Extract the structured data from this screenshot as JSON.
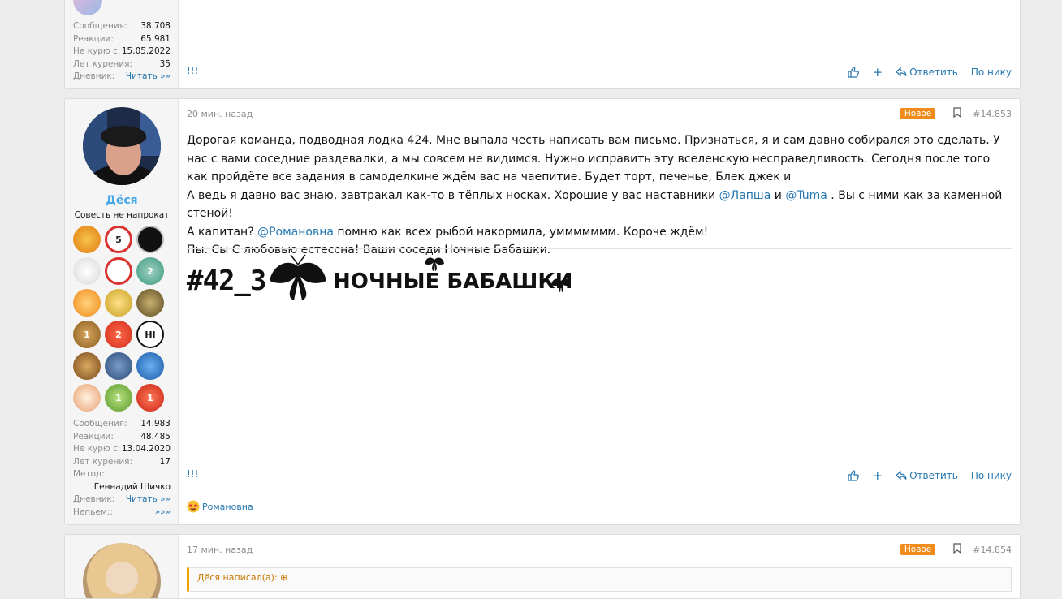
{
  "post1": {
    "stats": [
      {
        "label": "Сообщения:",
        "value": "38.708"
      },
      {
        "label": "Реакции:",
        "value": "65.981"
      },
      {
        "label": "Не курю с:",
        "value": "15.05.2022"
      },
      {
        "label": "Лет курения:",
        "value": "35"
      },
      {
        "label": "Дневник:",
        "value": "Читать »»"
      }
    ],
    "exclaim": "!!!",
    "actions": {
      "plus": "+",
      "reply": "Ответить",
      "by_nick": "По нику"
    }
  },
  "post2": {
    "time": "20 мин. назад",
    "badge": "Новое",
    "number": "#14.853",
    "username": "Дёся",
    "user_title": "Совесть не напрокат",
    "award_icons": [
      "flower-pot-award-icon",
      "no-5-award-icon",
      "spy-award-icon",
      "chef-award-icon",
      "no-drinks-award-icon",
      "cross-2-award-icon",
      "books-award-icon",
      "rescue-award-icon",
      "trophy-award-icon",
      "medal-1-award-icon",
      "apple-2-award-icon",
      "hi-hand-award-icon",
      "stars-award-icon",
      "person-award-icon",
      "book-award-icon",
      "bottle-award-icon",
      "plant-1-award-icon",
      "tomato-1-award-icon"
    ],
    "award_labels": {
      "a1": "5",
      "a5": "2",
      "a9": "1",
      "a10": "2",
      "a11": "HI",
      "a16": "1",
      "a17": "1"
    },
    "message": {
      "p1": "Дорогая команда, подводная лодка 424. Мне выпала честь написать вам письмо. Признаться, я и сам давно собирался это сделать. У нас с вами соседние раздевалки, а мы совсем не видимся. Нужно исправить эту вселенскую несправедливость. Сегодня после того как пройдёте все задания в самоделкине ждём вас на чаепитие. Будет торт, печенье, Блек джек и",
      "p2_a": "А ведь я давно вас знаю, завтракал как-то в тёплых носках. Хорошие у вас наставники ",
      "mention1": "@Лапша",
      "p2_b": " и ",
      "mention2": "@Tuma",
      "p2_c": " . Вы с ними как за каменной стеной!",
      "p3_a": "А капитан? ",
      "mention3": "@Романовна",
      "p3_b": " помню как всех рыбой накормила, уммммммм. Короче ждём!",
      "p4": "Пы. Сы С любовью естессна! Ваши соседи Ночные Бабашки."
    },
    "signature": {
      "tag": "#42_3",
      "text": "НОЧНЫЕ БАБАШКИ"
    },
    "stats": [
      {
        "label": "Сообщения:",
        "value": "14.983"
      },
      {
        "label": "Реакции:",
        "value": "48.485"
      },
      {
        "label": "Не курю с:",
        "value": "13.04.2020"
      },
      {
        "label": "Лет курения:",
        "value": "17"
      }
    ],
    "method_label": "Метод:",
    "method_value": "Геннадий Шичко",
    "diary": {
      "label": "Дневник:",
      "value": "Читать »»"
    },
    "nepyem": {
      "label": "Непьем::",
      "value": "»»»"
    },
    "exclaim": "!!!",
    "actions": {
      "plus": "+",
      "reply": "Ответить",
      "by_nick": "По нику"
    },
    "reaction_user": "Романовна"
  },
  "post3": {
    "time": "17 мин. назад",
    "badge": "Новое",
    "number": "#14.854",
    "quote": "Дёся написал(а): ⊕"
  },
  "colors": {
    "link": "#2577b1",
    "username": "#47a7eb",
    "badge": "#f08c1c",
    "muted": "#8c8c8c"
  }
}
